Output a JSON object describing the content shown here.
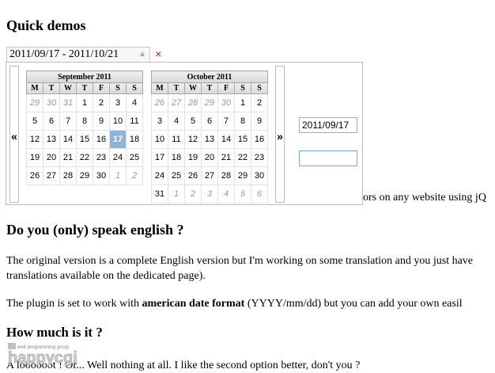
{
  "sections": {
    "quick_demos": "Quick demos",
    "intro_visible_fragment": "ors on any website using jQ",
    "speak_english": "Do you (only) speak english ?",
    "p1_line1": "The original version is a complete English version but I'm working on some translation and you just have",
    "p1_line2": "translations available on the dedicated page).",
    "p2_prefix": "The plugin is set to work with ",
    "p2_bold": "american date format",
    "p2_suffix": " (YYYY/mm/dd) but you can add your own easil",
    "how_much": "How much is it ?",
    "p3": "A loooooot ! Or... Well nothing at all. I like the second option better, don't you ?"
  },
  "range_input": {
    "value": "2011/09/17 - 2011/10/21",
    "caret": "▲",
    "clear": "×"
  },
  "picker": {
    "prev_label": "«",
    "next_label": "»",
    "weekdays": [
      "M",
      "T",
      "W",
      "T",
      "F",
      "S",
      "S"
    ],
    "months": [
      {
        "title": "September 2011",
        "weeks": [
          [
            {
              "d": "29",
              "o": true
            },
            {
              "d": "30",
              "o": true
            },
            {
              "d": "31",
              "o": true
            },
            {
              "d": "1"
            },
            {
              "d": "2"
            },
            {
              "d": "3"
            },
            {
              "d": "4"
            }
          ],
          [
            {
              "d": "5"
            },
            {
              "d": "6"
            },
            {
              "d": "7"
            },
            {
              "d": "8"
            },
            {
              "d": "9"
            },
            {
              "d": "10"
            },
            {
              "d": "11"
            }
          ],
          [
            {
              "d": "12"
            },
            {
              "d": "13"
            },
            {
              "d": "14"
            },
            {
              "d": "15"
            },
            {
              "d": "16"
            },
            {
              "d": "17",
              "s": true
            },
            {
              "d": "18"
            }
          ],
          [
            {
              "d": "19"
            },
            {
              "d": "20"
            },
            {
              "d": "21"
            },
            {
              "d": "22"
            },
            {
              "d": "23"
            },
            {
              "d": "24"
            },
            {
              "d": "25"
            }
          ],
          [
            {
              "d": "26"
            },
            {
              "d": "27"
            },
            {
              "d": "28"
            },
            {
              "d": "29"
            },
            {
              "d": "30"
            },
            {
              "d": "1",
              "o": true
            },
            {
              "d": "2",
              "o": true
            }
          ]
        ]
      },
      {
        "title": "October 2011",
        "weeks": [
          [
            {
              "d": "26",
              "o": true
            },
            {
              "d": "27",
              "o": true
            },
            {
              "d": "28",
              "o": true
            },
            {
              "d": "29",
              "o": true
            },
            {
              "d": "30",
              "o": true
            },
            {
              "d": "1"
            },
            {
              "d": "2"
            }
          ],
          [
            {
              "d": "3"
            },
            {
              "d": "4"
            },
            {
              "d": "5"
            },
            {
              "d": "6"
            },
            {
              "d": "7"
            },
            {
              "d": "8"
            },
            {
              "d": "9"
            }
          ],
          [
            {
              "d": "10"
            },
            {
              "d": "11"
            },
            {
              "d": "12"
            },
            {
              "d": "13"
            },
            {
              "d": "14"
            },
            {
              "d": "15"
            },
            {
              "d": "16"
            }
          ],
          [
            {
              "d": "17"
            },
            {
              "d": "18"
            },
            {
              "d": "19"
            },
            {
              "d": "20"
            },
            {
              "d": "21"
            },
            {
              "d": "22"
            },
            {
              "d": "23"
            }
          ],
          [
            {
              "d": "24"
            },
            {
              "d": "25"
            },
            {
              "d": "26"
            },
            {
              "d": "27"
            },
            {
              "d": "28"
            },
            {
              "d": "29"
            },
            {
              "d": "30"
            }
          ],
          [
            {
              "d": "31"
            },
            {
              "d": "1",
              "o": true
            },
            {
              "d": "2",
              "o": true
            },
            {
              "d": "3",
              "o": true
            },
            {
              "d": "4",
              "o": true
            },
            {
              "d": "5",
              "o": true
            },
            {
              "d": "6",
              "o": true
            }
          ]
        ]
      }
    ],
    "start_date_value": "2011/09/17",
    "end_date_value": ""
  },
  "watermark": {
    "brand": "happycgi",
    "tagline": "web programming group"
  },
  "colors": {
    "selected_day": "#8fb3d9",
    "clear_icon": "#dd1111",
    "focus_border": "#7aa6d6"
  }
}
